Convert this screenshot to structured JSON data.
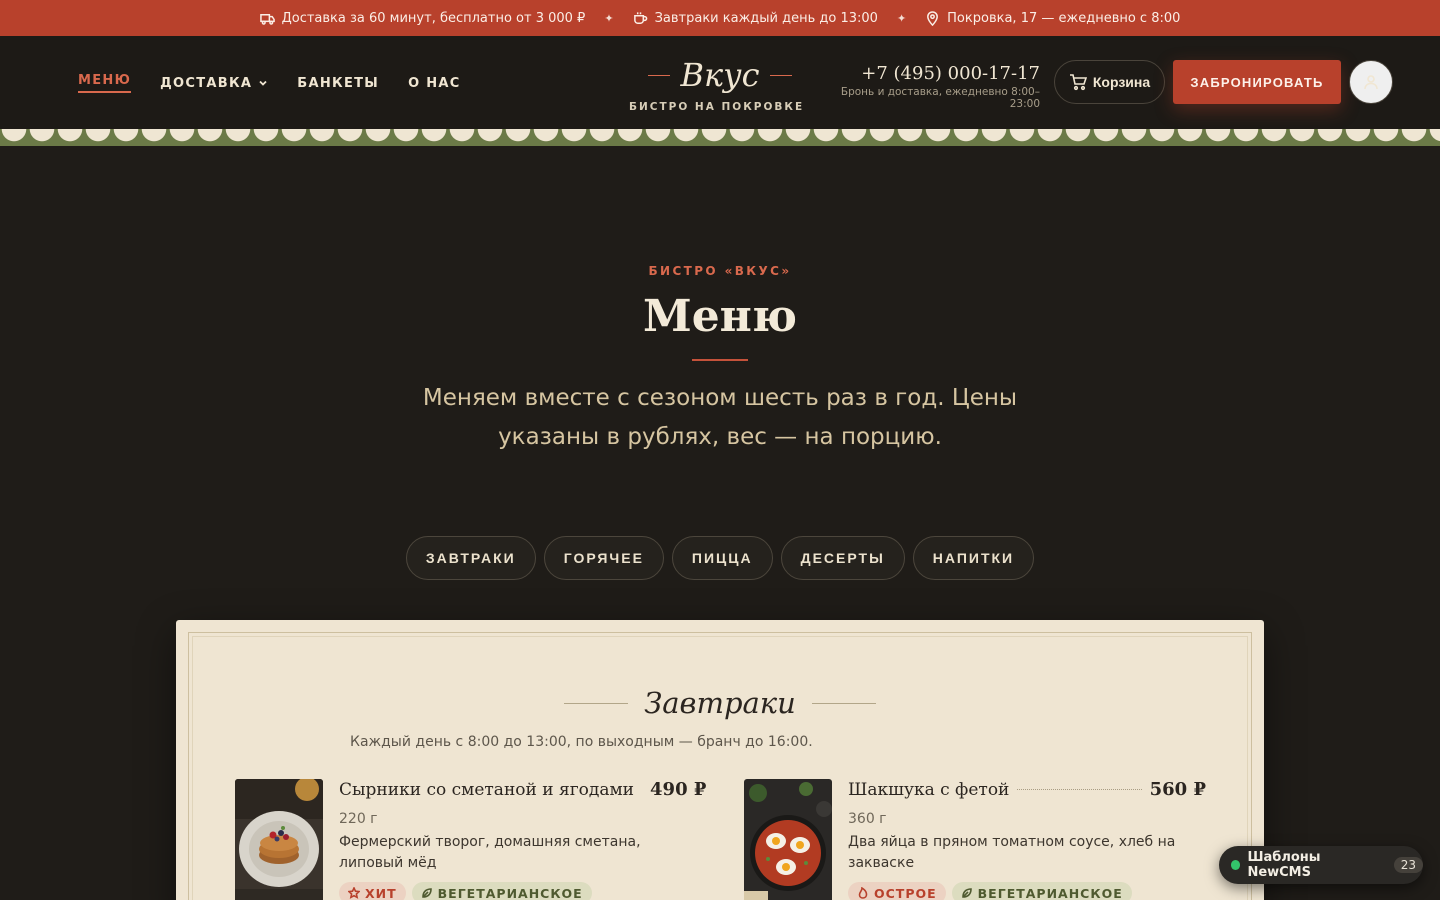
{
  "topbar": {
    "delivery": "Доставка за 60 минут, бесплатно от 3 000 ₽",
    "breakfast": "Завтраки каждый день до 13:00",
    "address": "Покровка, 17 — ежедневно с 8:00",
    "separator": "✦"
  },
  "nav": {
    "menu": "МЕНЮ",
    "delivery": "ДОСТАВКА",
    "banquets": "БАНКЕТЫ",
    "about": "О НАС"
  },
  "logo": {
    "name": "Вкус",
    "tagline": "БИСТРО НА ПОКРОВКЕ"
  },
  "contact": {
    "phone": "+7 (495) 000-17-17",
    "hours": "Бронь и доставка, ежедневно 8:00–23:00"
  },
  "header_actions": {
    "cart": "Корзина",
    "book": "ЗАБРОНИРОВАТЬ"
  },
  "hero": {
    "eyebrow": "БИСТРО «ВКУС»",
    "title": "Меню",
    "subtitle": "Меняем вместе с сезоном шесть раз в год. Цены указаны в рублях, вес — на порцию."
  },
  "categories": [
    "ЗАВТРАКИ",
    "ГОРЯЧЕЕ",
    "ПИЦЦА",
    "ДЕСЕРТЫ",
    "НАПИТКИ"
  ],
  "section": {
    "title": "Завтраки",
    "note": "Каждый день с 8:00 до 13:00, по выходным — бранч до 16:00."
  },
  "dishes": [
    {
      "name": "Сырники со сметаной и ягодами",
      "price": "490 ₽",
      "weight": "220 г",
      "description": "Фермерский творог, домашняя сметана, липовый мёд",
      "tags": [
        "ХИТ",
        "ВЕГЕТАРИАНСКОЕ"
      ]
    },
    {
      "name": "Шакшука с фетой",
      "price": "560 ₽",
      "weight": "360 г",
      "description": "Два яйца в пряном томатном соусе, хлеб на закваске",
      "tags": [
        "ОСТРОЕ",
        "ВЕГЕТАРИАНСКОЕ"
      ]
    }
  ],
  "cms_badge": {
    "label": "Шаблоны NewCMS",
    "count": "23"
  },
  "colors": {
    "accent": "#b8412c",
    "background": "#1f1c18",
    "card": "#efe5d2",
    "scallop_green": "#6b7a47"
  }
}
